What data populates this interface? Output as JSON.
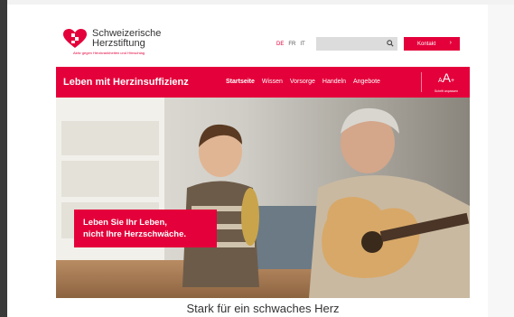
{
  "header": {
    "logo_line1": "Schweizerische",
    "logo_line2": "Herzstiftung",
    "logo_tagline": "Aktiv gegen Herzkrankheiten und Hirnschlag",
    "languages": [
      "DE",
      "FR",
      "IT"
    ],
    "active_language": "DE",
    "kontakt_label": "Kontakt"
  },
  "nav": {
    "title": "Leben mit Herzinsuffizienz",
    "items": [
      "Startseite",
      "Wissen",
      "Vorsorge",
      "Handeln",
      "Angebote"
    ],
    "active_item": "Startseite",
    "font_size_label": "Schrift anpassen"
  },
  "hero": {
    "caption_line1": "Leben Sie Ihr Leben,",
    "caption_line2": "nicht Ihre Herzschwäche."
  },
  "main": {
    "subtitle": "Stark für ein schwaches Herz"
  },
  "colors": {
    "brand": "#e4003a",
    "search_bg": "#dcdcdc"
  }
}
